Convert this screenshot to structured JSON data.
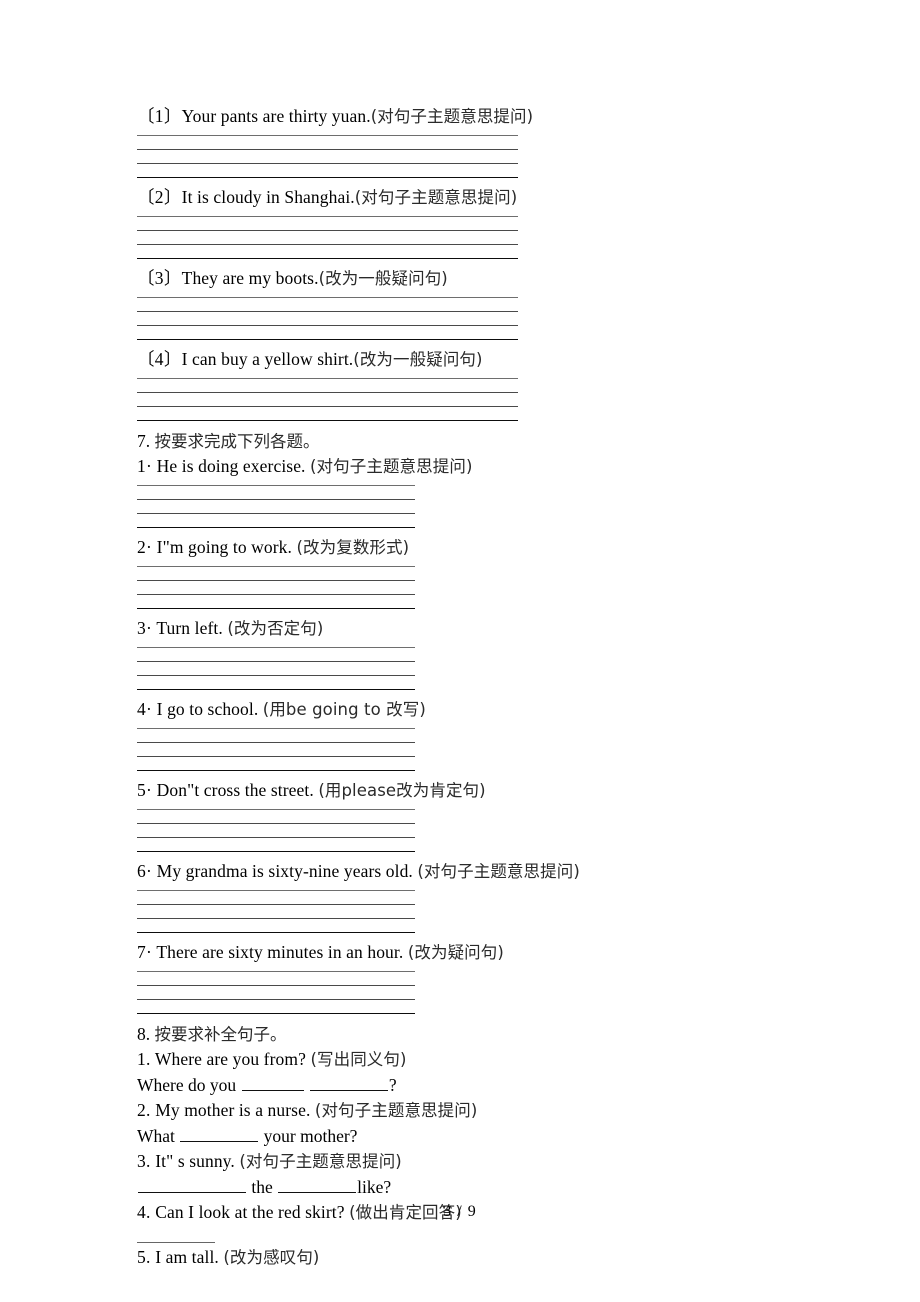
{
  "page": {
    "footer_label": "3 / 9"
  },
  "section6": {
    "items": [
      {
        "num": "〔1〕",
        "english": "Your pants are thirty yuan.",
        "instruction": "(对句子主题意思提问)"
      },
      {
        "num": "〔2〕",
        "english": "It is cloudy in Shanghai.",
        "instruction": "(对句子主题意思提问)"
      },
      {
        "num": "〔3〕",
        "english": "They are my boots.",
        "instruction": "(改为一般疑问句)"
      },
      {
        "num": "〔4〕",
        "english": "I can buy a yellow shirt.",
        "instruction": "(改为一般疑问句)"
      }
    ]
  },
  "section7": {
    "heading_num": "7.",
    "heading_cjk": "按要求完成下列各题。",
    "items": [
      {
        "num": "1·",
        "english": "He is doing exercise.",
        "instruction": "(对句子主题意思提问)"
      },
      {
        "num": "2·",
        "english": "I\"m going to work.",
        "instruction": "(改为复数形式)"
      },
      {
        "num": "3·",
        "english": "Turn left.",
        "instruction": "(改为否定句)"
      },
      {
        "num": "4·",
        "english": "I go to school.",
        "instruction": "(用be going to 改写)"
      },
      {
        "num": "5·",
        "english": "Don\"t cross the street.",
        "instruction": "(用please改为肯定句)"
      },
      {
        "num": "6·",
        "english": "My grandma is sixty-nine years old.",
        "instruction": "(对句子主题意思提问)"
      },
      {
        "num": "7·",
        "english": "There are sixty minutes in an hour.",
        "instruction": "(改为疑问句)"
      }
    ]
  },
  "section8": {
    "heading_num": "8.",
    "heading_cjk": "按要求补全句子。",
    "items": [
      {
        "num": "1.",
        "english": "Where are you from?",
        "instruction": "(写出同义句)",
        "answer_prefix": "Where do you",
        "answer_mid": "",
        "answer_suffix": "?"
      },
      {
        "num": "2.",
        "english": "My mother is a nurse.",
        "instruction": "(对句子主题意思提问)",
        "answer_prefix": "What",
        "answer_suffix": "your mother?"
      },
      {
        "num": "3.",
        "english": "It\" s sunny.",
        "instruction": "(对句子主题意思提问)",
        "answer_prefix": "",
        "answer_mid": "the",
        "answer_suffix": "like?"
      },
      {
        "num": "4.",
        "english": "Can I look at the red skirt?",
        "instruction": "(做出肯定回答)"
      },
      {
        "num": "5.",
        "english": "I am tall.",
        "instruction": "(改为感叹句)"
      }
    ]
  }
}
